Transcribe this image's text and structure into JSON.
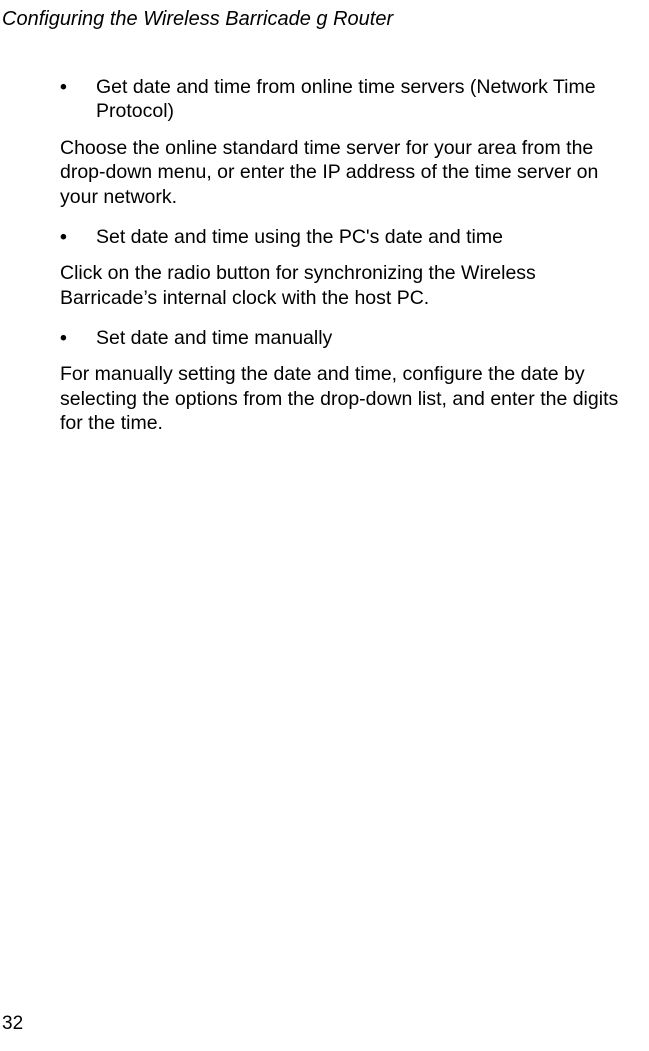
{
  "header": "Configuring the Wireless Barricade g Router",
  "bullets": [
    {
      "text": "Get date and time from online time servers (Network Time Protocol)",
      "followup": "Choose the online standard time server for your area from the drop-down menu, or enter the IP address of the time server on your network."
    },
    {
      "text": "Set date and time using the PC's date and time",
      "followup": "Click on the radio button for synchronizing the Wireless Barricade’s internal clock with the host PC."
    },
    {
      "text": "Set date and time manually",
      "followup": "For manually setting the date and time, configure the date by selecting the options from the drop-down list, and enter the digits for the time."
    }
  ],
  "bullet_char": "•",
  "page_number": "32"
}
